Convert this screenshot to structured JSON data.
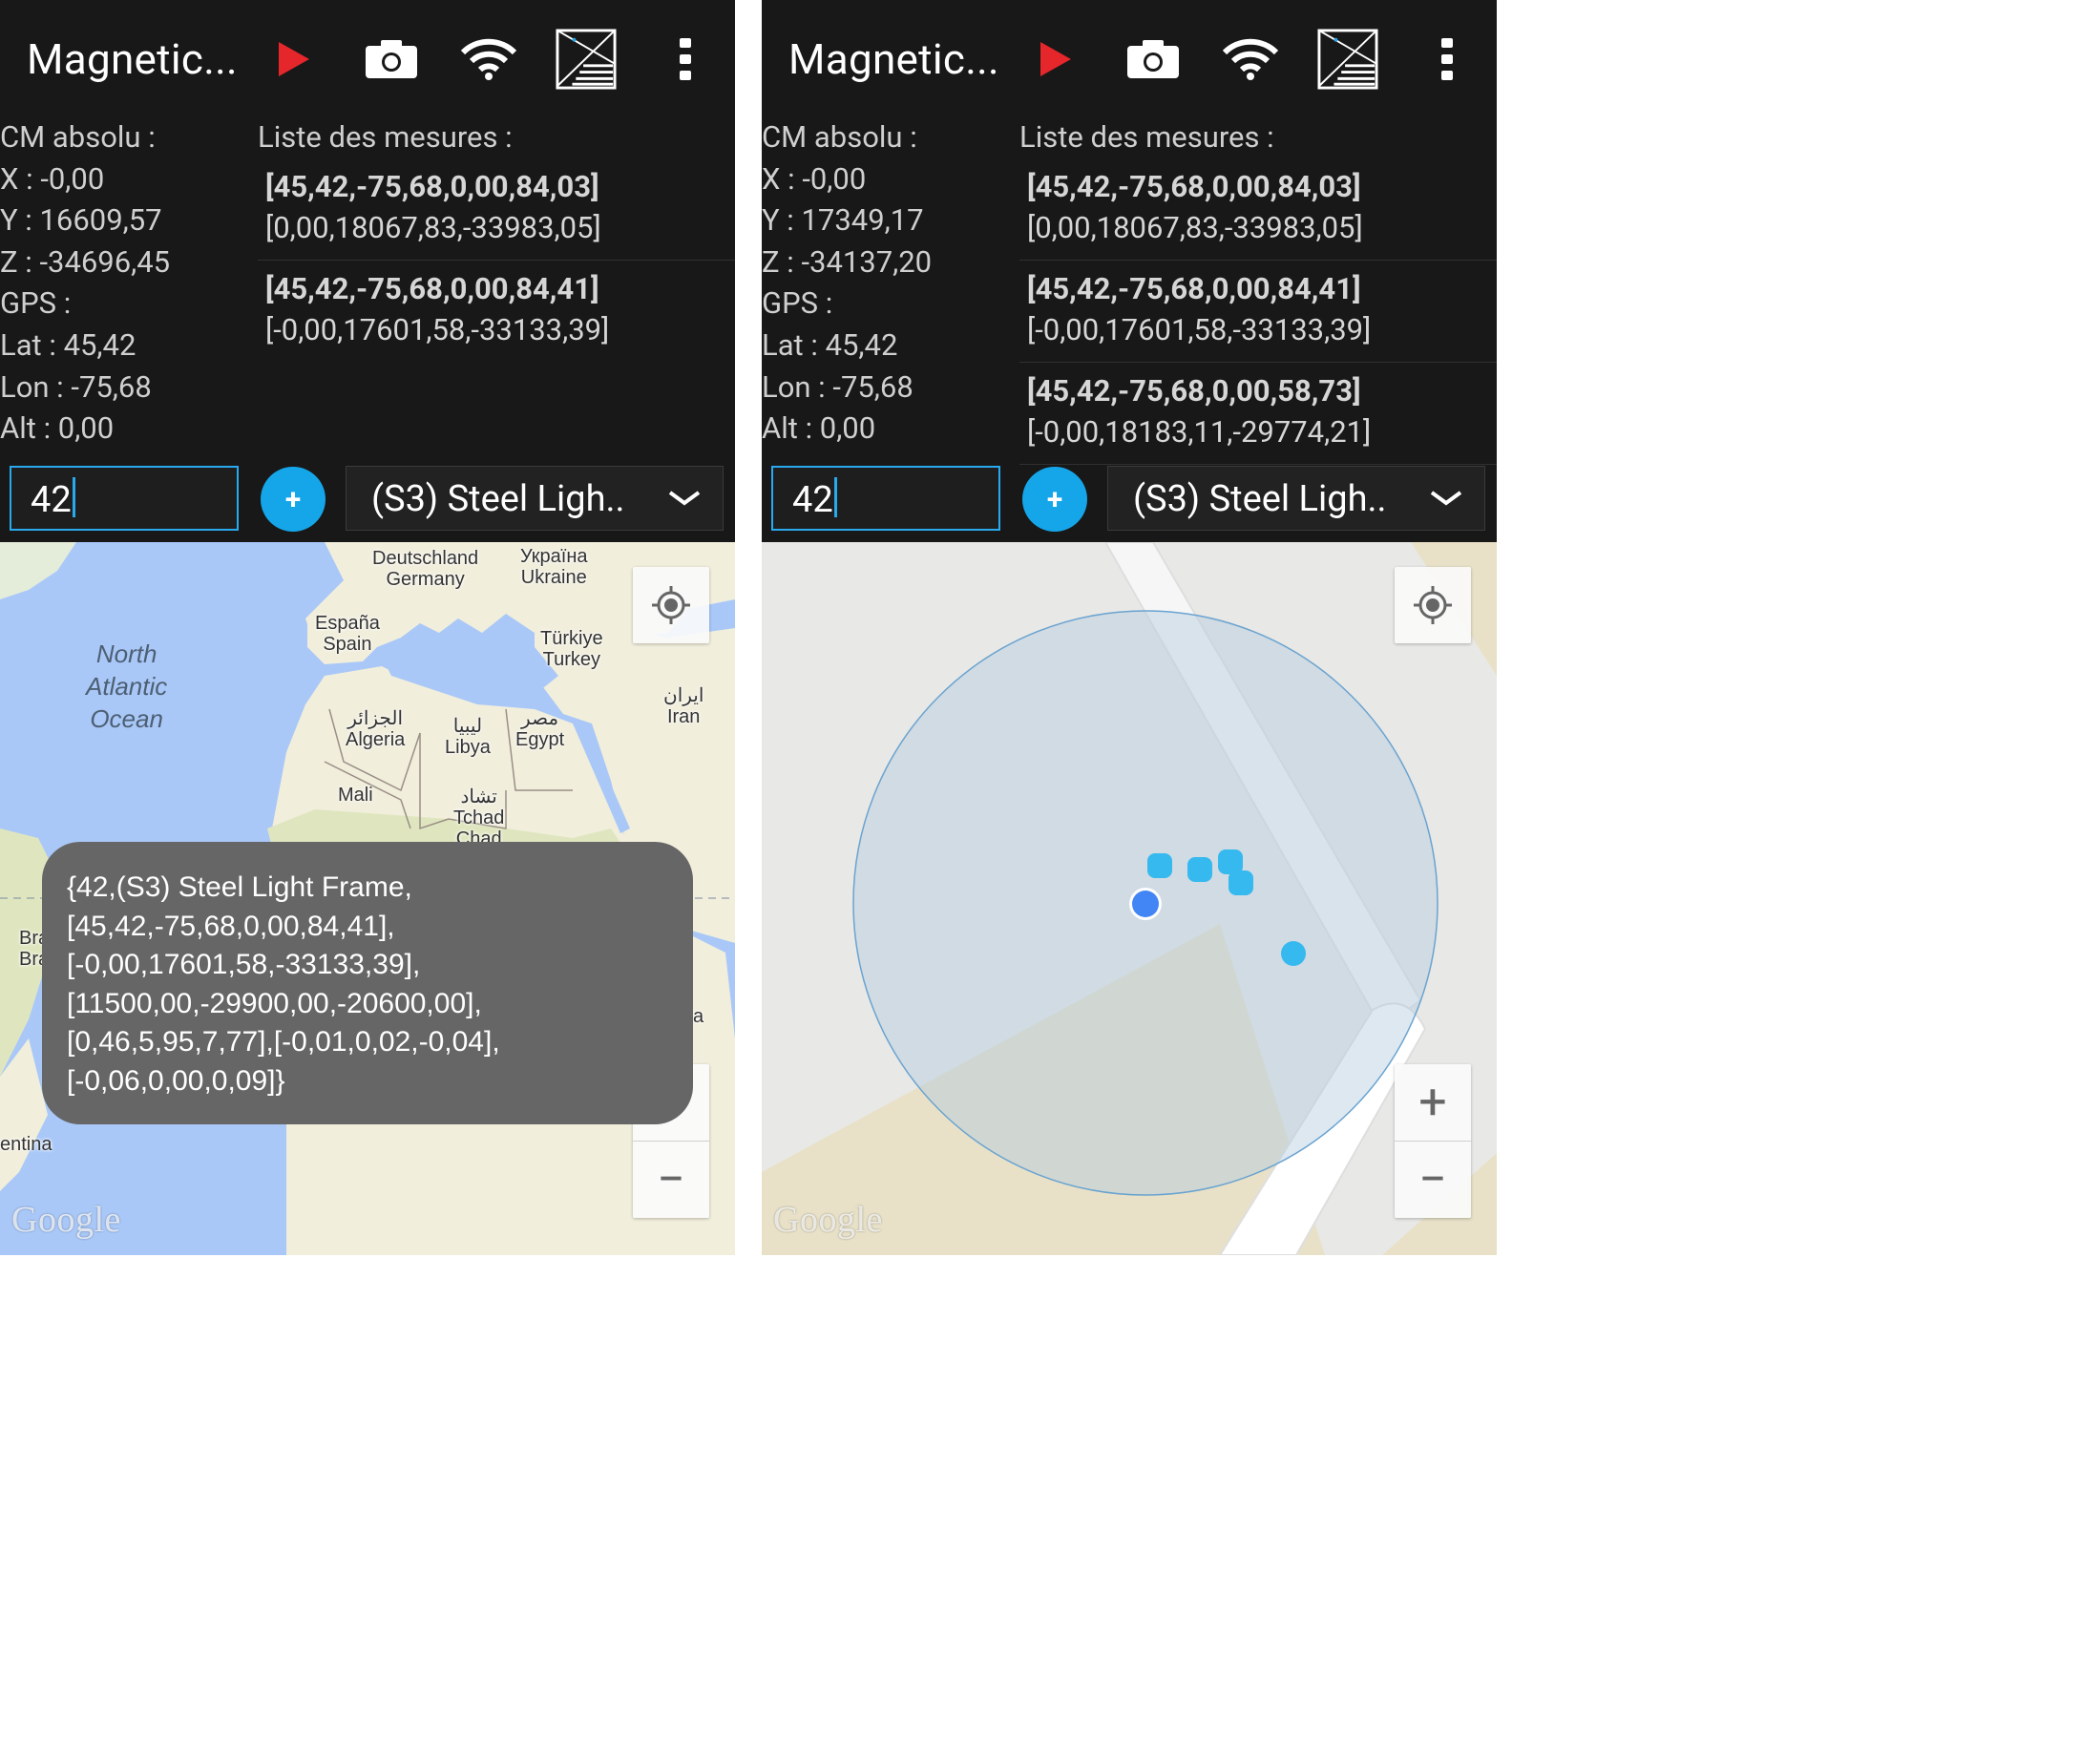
{
  "app": {
    "title": "Magnetic...",
    "icons": [
      "play-icon",
      "camera-icon",
      "wifi-icon",
      "chart-icon",
      "more-vert-icon"
    ]
  },
  "colors": {
    "accent": "#15a6e9",
    "play": "#e5262b",
    "toolbar": "#181818",
    "ocean": "#a9c8f8",
    "land": "#f1eedc"
  },
  "left_screen": {
    "cm_label": "CM absolu :",
    "x": "X : -0,00",
    "y": "Y : 16609,57",
    "z": "Z : -34696,45",
    "gps_label": "GPS :",
    "lat": "Lat : 45,42",
    "lon": "Lon : -75,68",
    "alt": "Alt : 0,00",
    "list_header": "Liste des mesures :",
    "measurements": [
      {
        "main": "[45,42,-75,68,0,00,84,03]",
        "sub": "[0,00,18067,83,-33983,05]"
      },
      {
        "main": "[45,42,-75,68,0,00,84,41]",
        "sub": "[-0,00,17601,58,-33133,39]"
      }
    ],
    "input_value": "42",
    "add_label": "+",
    "dropdown_value": "(S3) Steel Ligh..",
    "map_labels": {
      "germany": "Deutschland\nGermany",
      "ukraine": "Україна\nUkraine",
      "spain": "España\nSpain",
      "turkey": "Türkiye\nTurkey",
      "ocean": "North\nAtlantic\nOcean",
      "algeria": "الجزائر\nAlgeria",
      "libya": "ليبيا\nLibya",
      "egypt": "مصر\nEgypt",
      "iran": "ایران\nIran",
      "mali": "Mali",
      "chad": "تشاد\nTchad\nChad",
      "brazil": "Bra\nBra",
      "argentina": "entina",
      "partial_a": "a"
    },
    "toast_lines": [
      "{42,(S3) Steel Light Frame,",
      "[45,42,-75,68,0,00,84,41],",
      "[-0,00,17601,58,-33133,39],",
      "[11500,00,-29900,00,-20600,00],",
      "[0,46,5,95,7,77],[-0,01,0,02,-0,04],",
      "[-0,06,0,00,0,09]}"
    ],
    "google": "Google"
  },
  "right_screen": {
    "cm_label": "CM absolu :",
    "x": "X : -0,00",
    "y": "Y : 17349,17",
    "z": "Z : -34137,20",
    "gps_label": "GPS :",
    "lat": "Lat : 45,42",
    "lon": "Lon : -75,68",
    "alt": "Alt : 0,00",
    "list_header": "Liste des mesures :",
    "measurements": [
      {
        "main": "[45,42,-75,68,0,00,84,03]",
        "sub": "[0,00,18067,83,-33983,05]"
      },
      {
        "main": "[45,42,-75,68,0,00,84,41]",
        "sub": "[-0,00,17601,58,-33133,39]"
      },
      {
        "main": "[45,42,-75,68,0,00,58,73]",
        "sub": "[-0,00,18183,11,-29774,21]"
      }
    ],
    "input_value": "42",
    "add_label": "+",
    "dropdown_value": "(S3) Steel Ligh..",
    "google": "Google",
    "zoom_in": "+",
    "zoom_out": "−"
  }
}
